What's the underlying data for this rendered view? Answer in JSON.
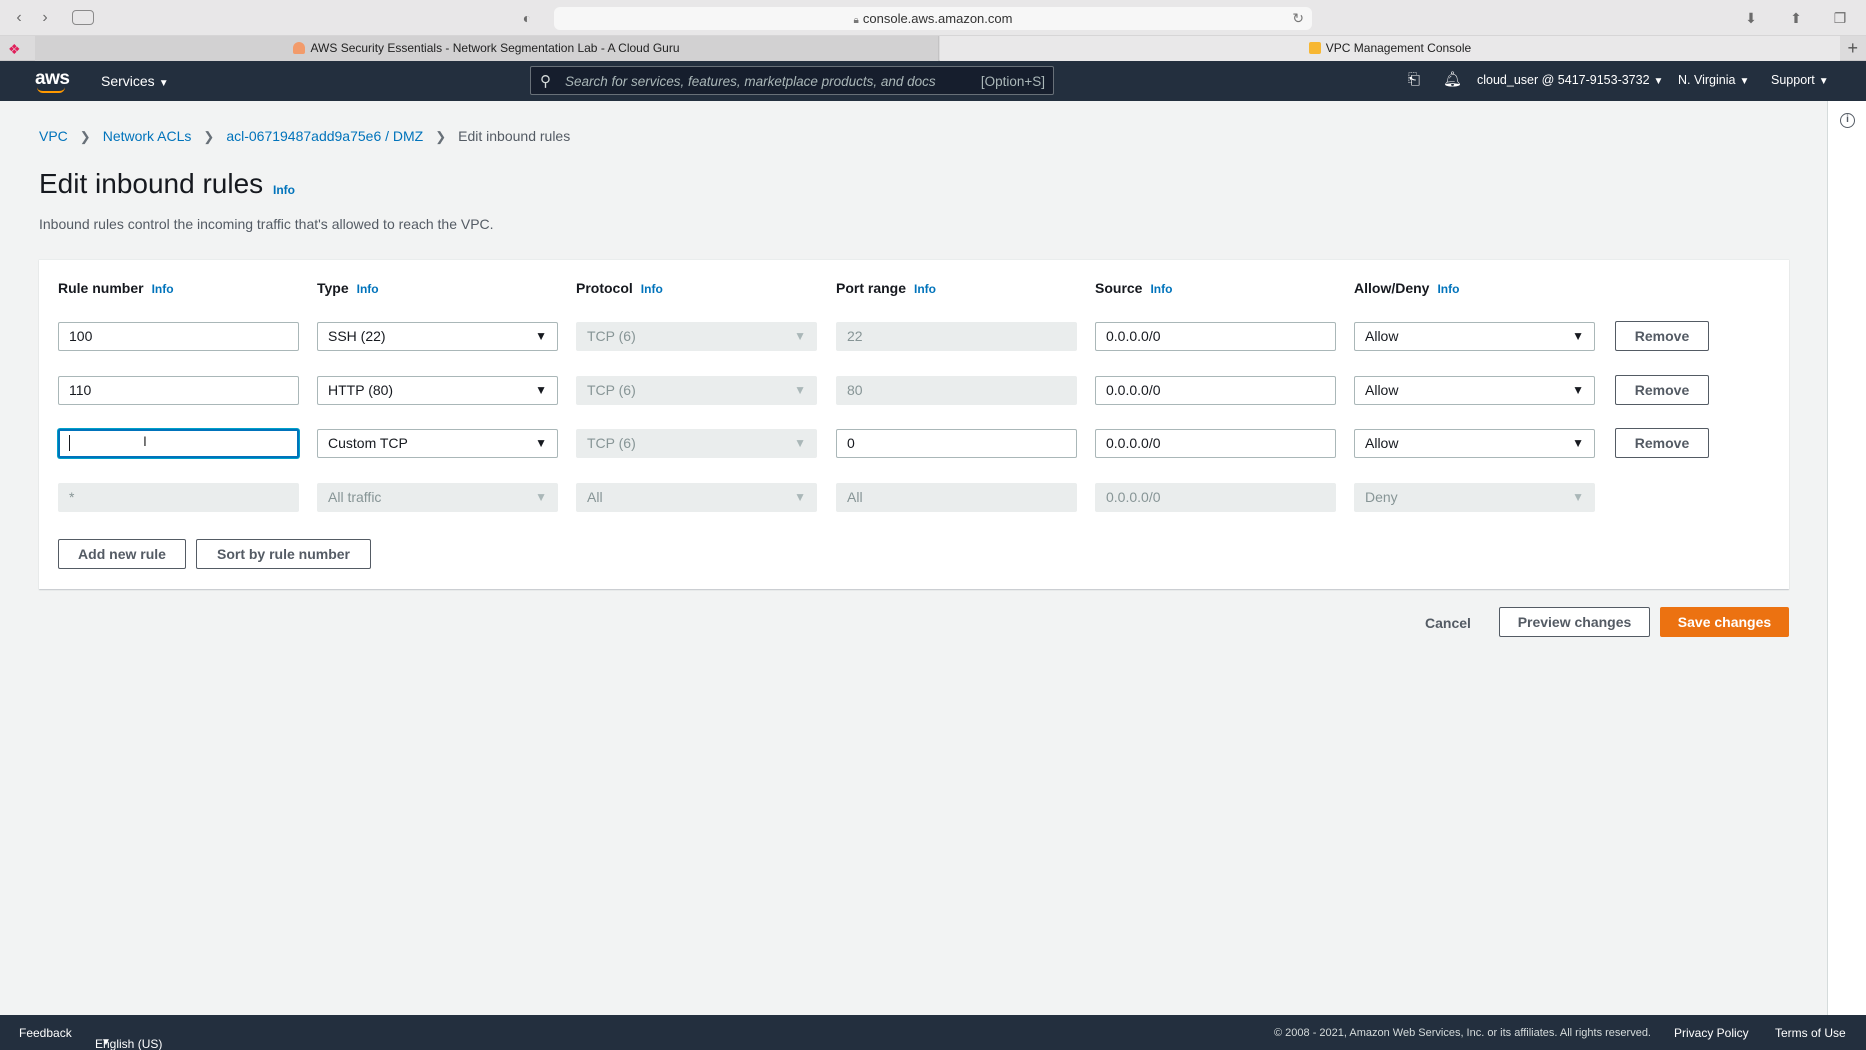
{
  "browser": {
    "url": "console.aws.amazon.com",
    "tabs": [
      {
        "title": "AWS Security Essentials - Network Segmentation Lab - A Cloud Guru",
        "favicon_color": "#f29b6b"
      },
      {
        "title": "VPC Management Console",
        "favicon_color": "#f7b733"
      }
    ]
  },
  "nav": {
    "logo": "aws",
    "services": "Services",
    "search_placeholder": "Search for services, features, marketplace products, and docs",
    "search_shortcut": "[Option+S]",
    "account": "cloud_user @ 5417-9153-3732",
    "region": "N. Virginia",
    "support": "Support"
  },
  "breadcrumb": {
    "vpc": "VPC",
    "network_acls": "Network ACLs",
    "acl": "acl-06719487add9a75e6 / DMZ",
    "current": "Edit inbound rules"
  },
  "page": {
    "title": "Edit inbound rules",
    "info": "Info",
    "description": "Inbound rules control the incoming traffic that's allowed to reach the VPC."
  },
  "columns": {
    "rule_number": "Rule number",
    "type": "Type",
    "protocol": "Protocol",
    "port_range": "Port range",
    "source": "Source",
    "allow_deny": "Allow/Deny",
    "info": "Info"
  },
  "rules": [
    {
      "rule_number": "100",
      "type": "SSH (22)",
      "protocol": "TCP (6)",
      "port_range": "22",
      "source": "0.0.0.0/0",
      "action": "Allow",
      "remove": "Remove"
    },
    {
      "rule_number": "110",
      "type": "HTTP (80)",
      "protocol": "TCP (6)",
      "port_range": "80",
      "source": "0.0.0.0/0",
      "action": "Allow",
      "remove": "Remove"
    },
    {
      "rule_number": "",
      "type": "Custom TCP",
      "protocol": "TCP (6)",
      "port_range": "0",
      "source": "0.0.0.0/0",
      "action": "Allow",
      "remove": "Remove"
    },
    {
      "rule_number": "*",
      "type": "All traffic",
      "protocol": "All",
      "port_range": "All",
      "source": "0.0.0.0/0",
      "action": "Deny"
    }
  ],
  "actions": {
    "add_rule": "Add new rule",
    "sort": "Sort by rule number",
    "cancel": "Cancel",
    "preview": "Preview changes",
    "save": "Save changes"
  },
  "footer": {
    "feedback": "Feedback",
    "language": "English (US)",
    "copyright": "© 2008 - 2021, Amazon Web Services, Inc. or its affiliates. All rights reserved.",
    "privacy": "Privacy Policy",
    "terms": "Terms of Use"
  }
}
